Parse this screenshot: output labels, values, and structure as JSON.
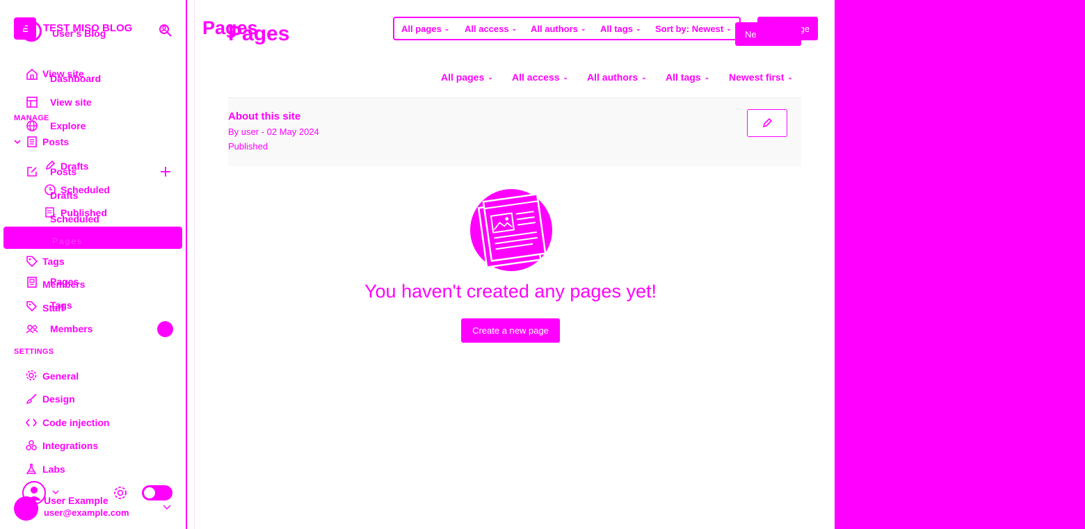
{
  "colors": {
    "accent": "#ff00ff",
    "background": "#ffffff"
  },
  "brand": {
    "logo_letters": "E",
    "title": "TEST MISO BLOG",
    "subtitle": "User's Blog"
  },
  "sidebar": {
    "primary": [
      {
        "label": "View site",
        "icon": "home-icon"
      },
      {
        "label": "Dashboard",
        "icon": "dashboard-icon"
      },
      {
        "label": "View site",
        "icon": "layout-icon"
      },
      {
        "label": "Explore",
        "icon": "globe-icon"
      }
    ],
    "manage_heading": "MANAGE",
    "posts_group": {
      "label": "Posts",
      "children": [
        "Drafts",
        "Scheduled",
        "Published"
      ]
    },
    "posts_secondary": {
      "label": "Posts",
      "children": [
        "Drafts",
        "Scheduled"
      ]
    },
    "active_item": "Pages",
    "manage_items": [
      {
        "label": "Tags",
        "icon": "tag-icon"
      },
      {
        "label": "Members",
        "icon": "members-icon"
      },
      {
        "label": "Pages",
        "icon": "pages-icon"
      },
      {
        "label": "Staff",
        "icon": "staff-icon"
      },
      {
        "label": "Tags",
        "icon": "tag-icon"
      },
      {
        "label": "Members",
        "icon": "members-icon"
      }
    ],
    "settings_heading": "SETTINGS",
    "settings_items": [
      {
        "label": "General",
        "icon": "gear-icon"
      },
      {
        "label": "Design",
        "icon": "brush-icon"
      },
      {
        "label": "Code injection",
        "icon": "code-icon"
      },
      {
        "label": "Integrations",
        "icon": "integrations-icon"
      },
      {
        "label": "Labs",
        "icon": "flask-icon"
      }
    ],
    "user": {
      "name": "User Example",
      "email": "user@example.com"
    }
  },
  "header": {
    "title_back": "Pages",
    "title_front": "Pages",
    "filters": [
      "All pages",
      "All access",
      "All authors",
      "All tags",
      "Sort by: Newest"
    ],
    "new_page_button": "New page",
    "new_page_partial": "Ne",
    "new_page_tail": "ge"
  },
  "filters_secondary": [
    "All pages",
    "All access",
    "All authors",
    "All tags",
    "Newest first"
  ],
  "page_item": {
    "title": "About this site",
    "meta": "By user - 02 May 2024",
    "status": "Published"
  },
  "empty_state": {
    "message": "You haven't created any pages yet!",
    "button": "Create a new page"
  }
}
